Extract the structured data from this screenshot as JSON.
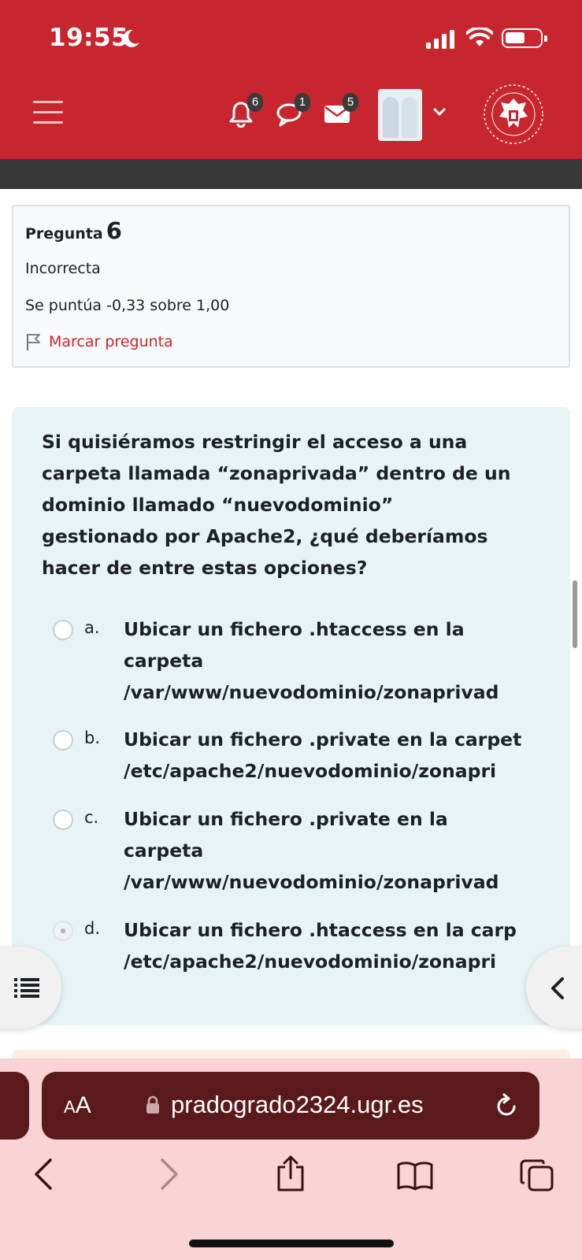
{
  "status_bar": {
    "time": "19:55"
  },
  "header": {
    "notifications_count": "6",
    "messages_count": "1",
    "mail_count": "5",
    "icons": [
      "menu-icon",
      "bell-icon",
      "chat-icon",
      "mail-icon",
      "chevron-down-icon",
      "university-seal"
    ]
  },
  "question_info": {
    "label": "Pregunta",
    "number": "6",
    "state": "Incorrecta",
    "grade": "Se puntúa -0,33 sobre 1,00",
    "flag_label": "Marcar pregunta"
  },
  "question": {
    "text_lines": [
      "Si quisiéramos restringir el acceso a una",
      "carpeta llamada “zonaprivada” dentro de un",
      "dominio llamado “nuevodominio”",
      "gestionado por Apache2, ¿qué deberíamos",
      "hacer de entre estas opciones?"
    ],
    "options": [
      {
        "letter": "a.",
        "lines": [
          "Ubicar un fichero .htaccess en la",
          "carpeta",
          "/var/www/nuevodominio/zonaprivad"
        ]
      },
      {
        "letter": "b.",
        "lines": [
          "Ubicar un fichero .private en la carpet",
          "/etc/apache2/nuevodominio/zonapri "
        ]
      },
      {
        "letter": "c.",
        "lines": [
          "Ubicar un fichero .private en la",
          "carpeta",
          "/var/www/nuevodominio/zonaprivad"
        ]
      },
      {
        "letter": "d.",
        "lines": [
          "Ubicar un fichero .htaccess en la carp",
          "/etc/apache2/nuevodominio/zonapri"
        ]
      }
    ]
  },
  "browser": {
    "text_size_label_big": "A",
    "text_size_label_small": "A",
    "url": "pradogrado2324.ugr.es"
  },
  "colors": {
    "brand_red": "#c8262e",
    "question_bg": "#e7f3f5",
    "safari_bar": "#5a1a1c"
  }
}
